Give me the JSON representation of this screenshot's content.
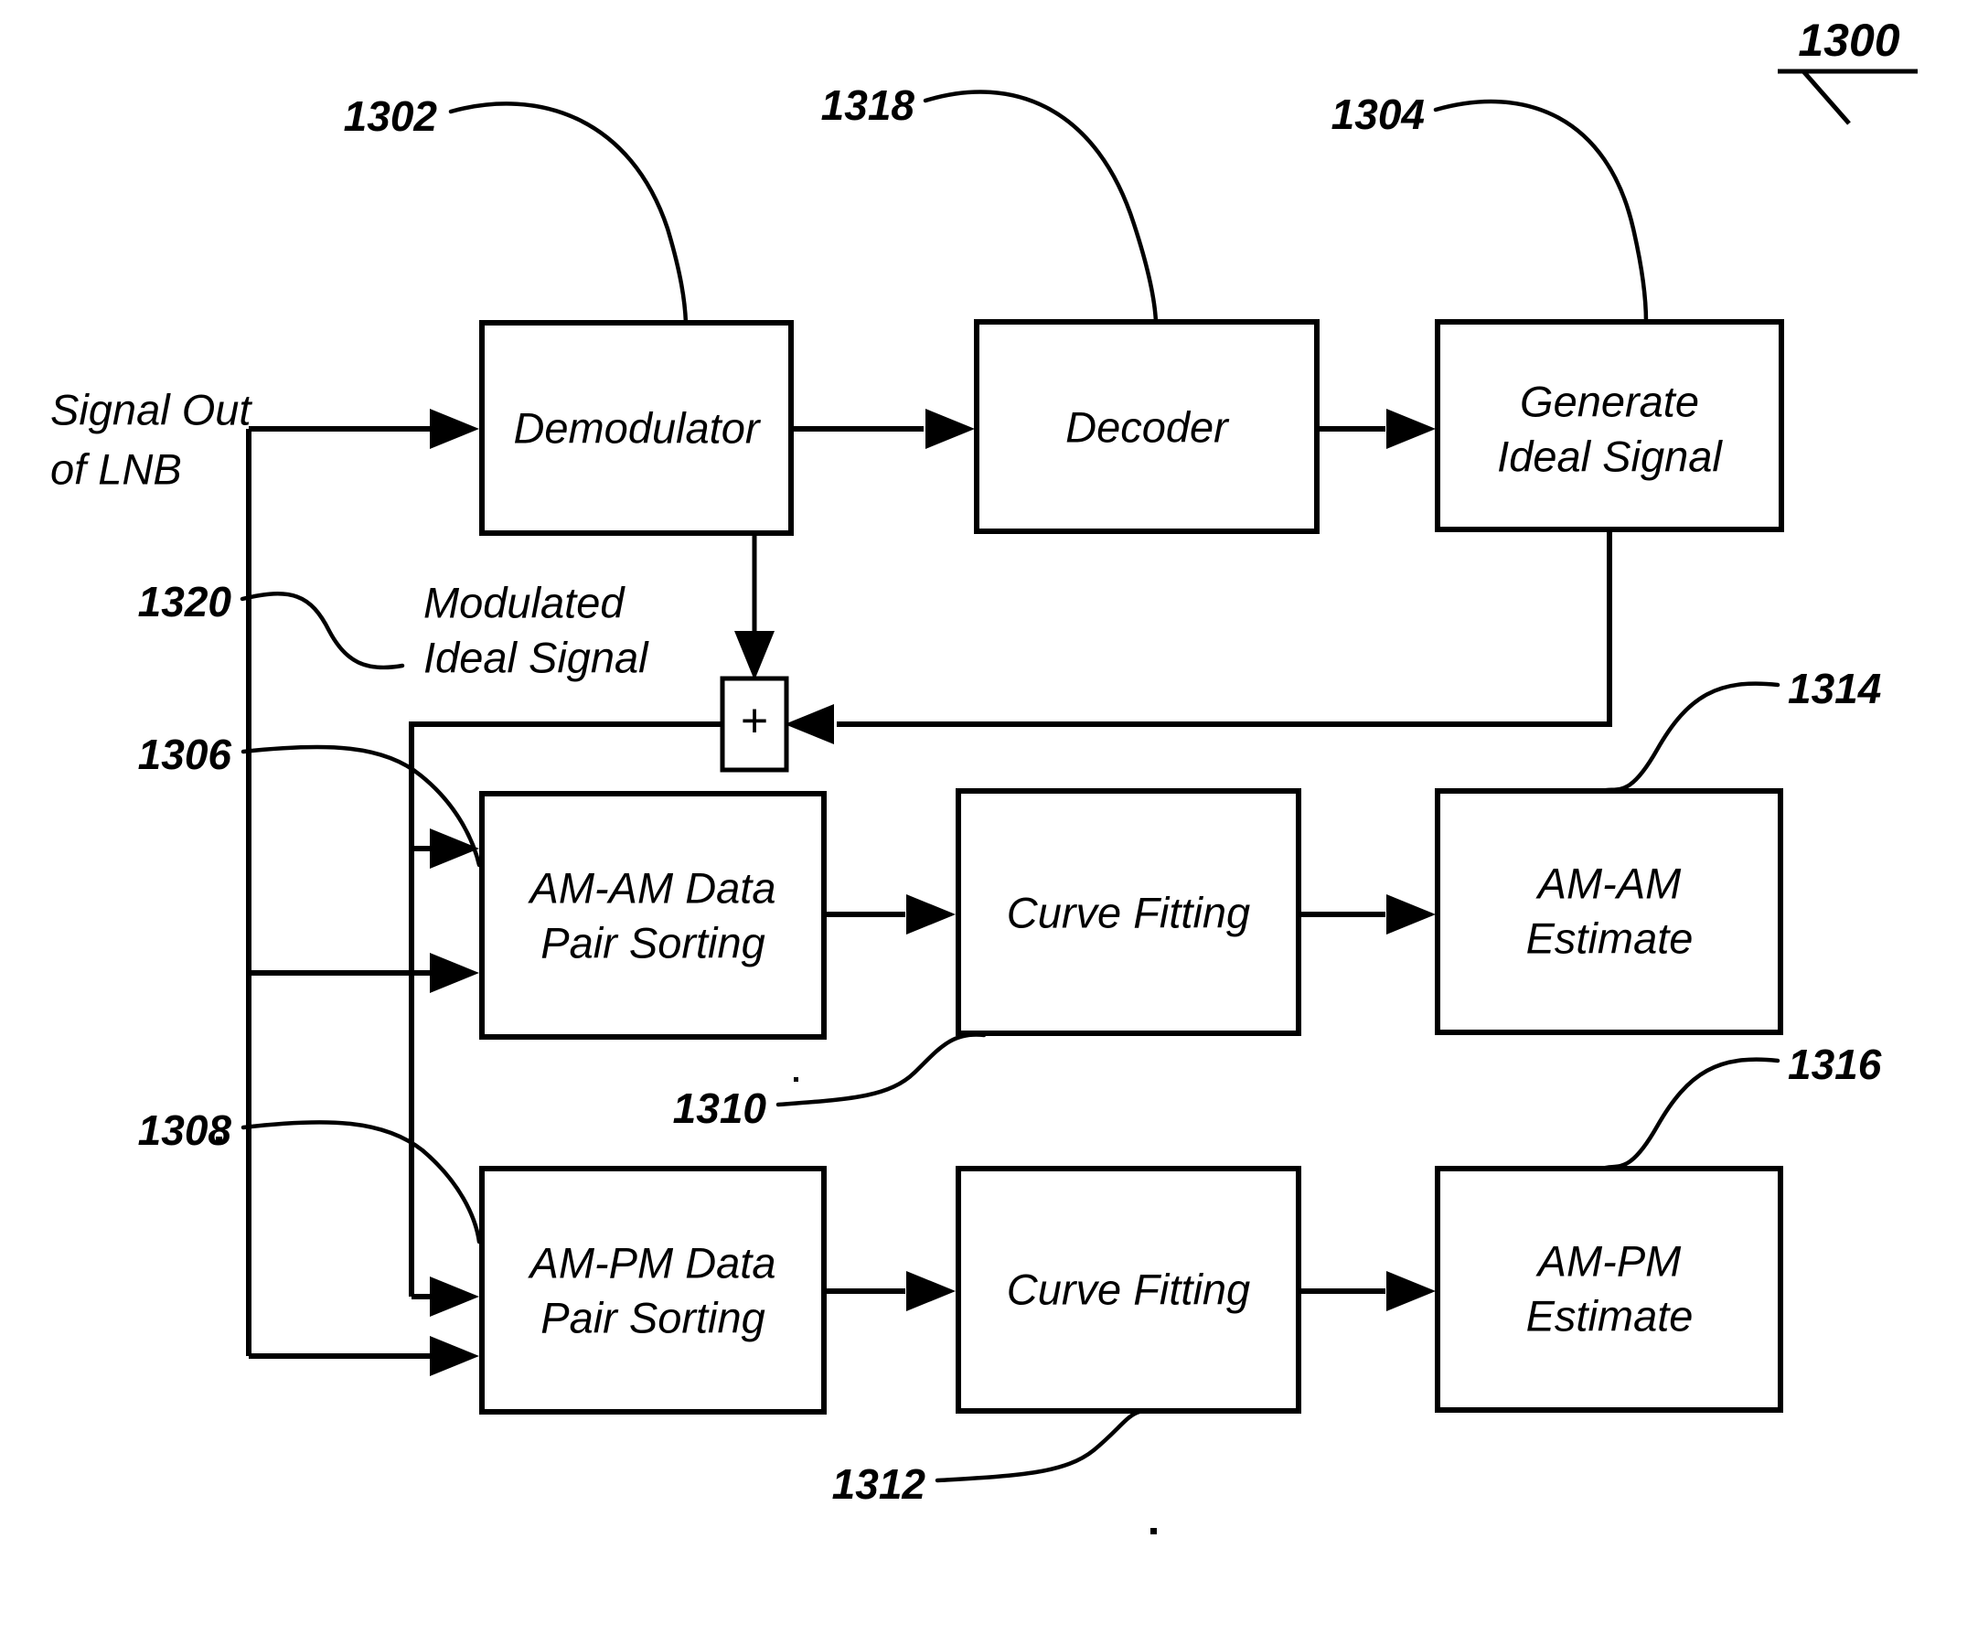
{
  "figure": {
    "number": "1300",
    "title_underline": true
  },
  "signals": {
    "input_label_line1": "Signal Out",
    "input_label_line2": "of LNB",
    "modulated_label_line1": "Modulated",
    "modulated_label_line2": "Ideal Signal",
    "sum_symbol": "+"
  },
  "blocks": [
    {
      "id": "demodulator",
      "label_line1": "Demodulator",
      "label_line2": "",
      "ref": "1302"
    },
    {
      "id": "decoder",
      "label_line1": "Decoder",
      "label_line2": "",
      "ref": "1318"
    },
    {
      "id": "generate-ideal-signal",
      "label_line1": "Generate",
      "label_line2": "Ideal Signal",
      "ref": "1304"
    },
    {
      "id": "am-am-data-pair-sorting",
      "label_line1": "AM-AM Data",
      "label_line2": "Pair Sorting",
      "ref": "1306"
    },
    {
      "id": "am-am-curve-fitting",
      "label_line1": "Curve Fitting",
      "label_line2": "",
      "ref": "1310"
    },
    {
      "id": "am-am-estimate",
      "label_line1": "AM-AM",
      "label_line2": "Estimate",
      "ref": "1314"
    },
    {
      "id": "am-pm-data-pair-sorting",
      "label_line1": "AM-PM Data",
      "label_line2": "Pair Sorting",
      "ref": "1308"
    },
    {
      "id": "am-pm-curve-fitting",
      "label_line1": "Curve Fitting",
      "label_line2": "",
      "ref": "1312"
    },
    {
      "id": "am-pm-estimate",
      "label_line1": "AM-PM",
      "label_line2": "Estimate",
      "ref": "1316"
    }
  ],
  "reference_numerals": {
    "n1300": "1300",
    "n1302": "1302",
    "n1304": "1304",
    "n1306": "1306",
    "n1308": "1308",
    "n1310": "1310",
    "n1312": "1312",
    "n1314": "1314",
    "n1316": "1316",
    "n1318": "1318",
    "n1320": "1320"
  },
  "colors": {
    "ink": "#000000",
    "paper": "#ffffff"
  }
}
